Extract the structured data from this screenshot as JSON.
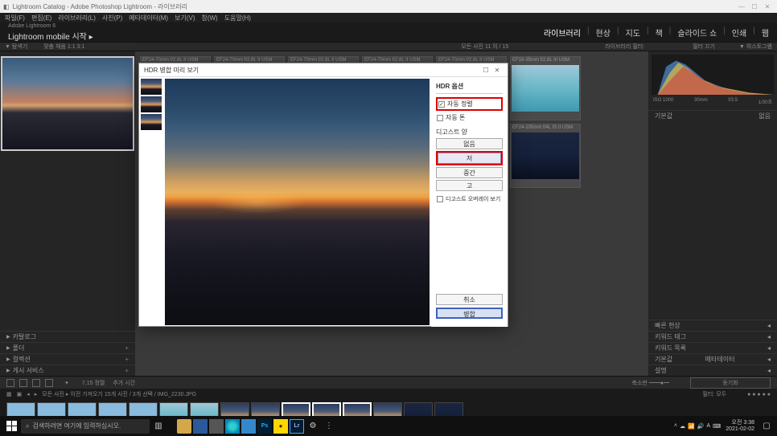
{
  "titlebar": {
    "text": "Lightroom Catalog - Adobe Photoshop Lightroom - 라이브러리"
  },
  "menubar": {
    "items": [
      "파일(F)",
      "편집(E)",
      "라이브러리(L)",
      "사진(P)",
      "메타데이터(M)",
      "보기(V)",
      "창(W)",
      "도움말(H)"
    ]
  },
  "brand": {
    "line1": "Adobe Lightroom 6",
    "line2": "Lightroom mobile 시작  ▸"
  },
  "modules": {
    "items": [
      "라이브러리",
      "현상",
      "지도",
      "책",
      "슬라이드 쇼",
      "인쇄",
      "웹"
    ]
  },
  "subbar_left": {
    "nav": "▼ 탐색기",
    "fit": "맞춤   채움   1:1   3:1"
  },
  "subbar_center": {
    "text": "모든 사진 11 의 / 15"
  },
  "subbar_right": {
    "filter": "라이브러리 필터:",
    "off": "필터 끄기"
  },
  "left_panels": [
    "카탈로그",
    "폴더",
    "컬렉션",
    "게시 서비스"
  ],
  "thumbs_labels": [
    "EF24-70mm f/2.8L II USM",
    "EF24-70mm f/2.8L II USM",
    "EF24-70mm f/2.8L II USM",
    "EF24-70mm f/2.8L II USM",
    "EF24-70mm f/2.8L II USM",
    "EF16-35mm f/2.8L III USM",
    "EF16-35mm f/2.8L III USM",
    "EF24-105mm f/4L IS II USM"
  ],
  "histogram_meta": {
    "iso": "ISO 1000",
    "lens": "30mm",
    "ap": "f/3.5",
    "sh": "1/30초"
  },
  "right_panels": [
    [
      "기본값",
      "없음"
    ],
    [
      "빠른 현상",
      ""
    ],
    [
      "키워드 태그",
      ""
    ],
    [
      "키워드 목록",
      ""
    ],
    [
      "메타데이터",
      "기본값"
    ],
    [
      "설명",
      ""
    ]
  ],
  "toolbar": {
    "sort": "7,15   정렬",
    "unflag": "추가 시간"
  },
  "filmbar": {
    "text": "모든 사진 ▸ 이전 가져오기   15개 사진 / 3개 선택 / IMG_2230.JPG",
    "right": "필터: 모두"
  },
  "dialog": {
    "title": "HDR 병합 미리 보기",
    "section": "HDR 옵션",
    "auto_align": "자동 정렬",
    "auto_tone": "자동 톤",
    "deghost_label": "디고스트 양",
    "deghost": [
      "없음",
      "저",
      "중간",
      "고"
    ],
    "overlay": "디고스트 오버레이 보기",
    "cancel": "취소",
    "merge": "병합"
  },
  "taskbar": {
    "search": "검색하려면 여기에 입력하십시오.",
    "time": "오전 3:38",
    "date": "2021-02-02"
  }
}
